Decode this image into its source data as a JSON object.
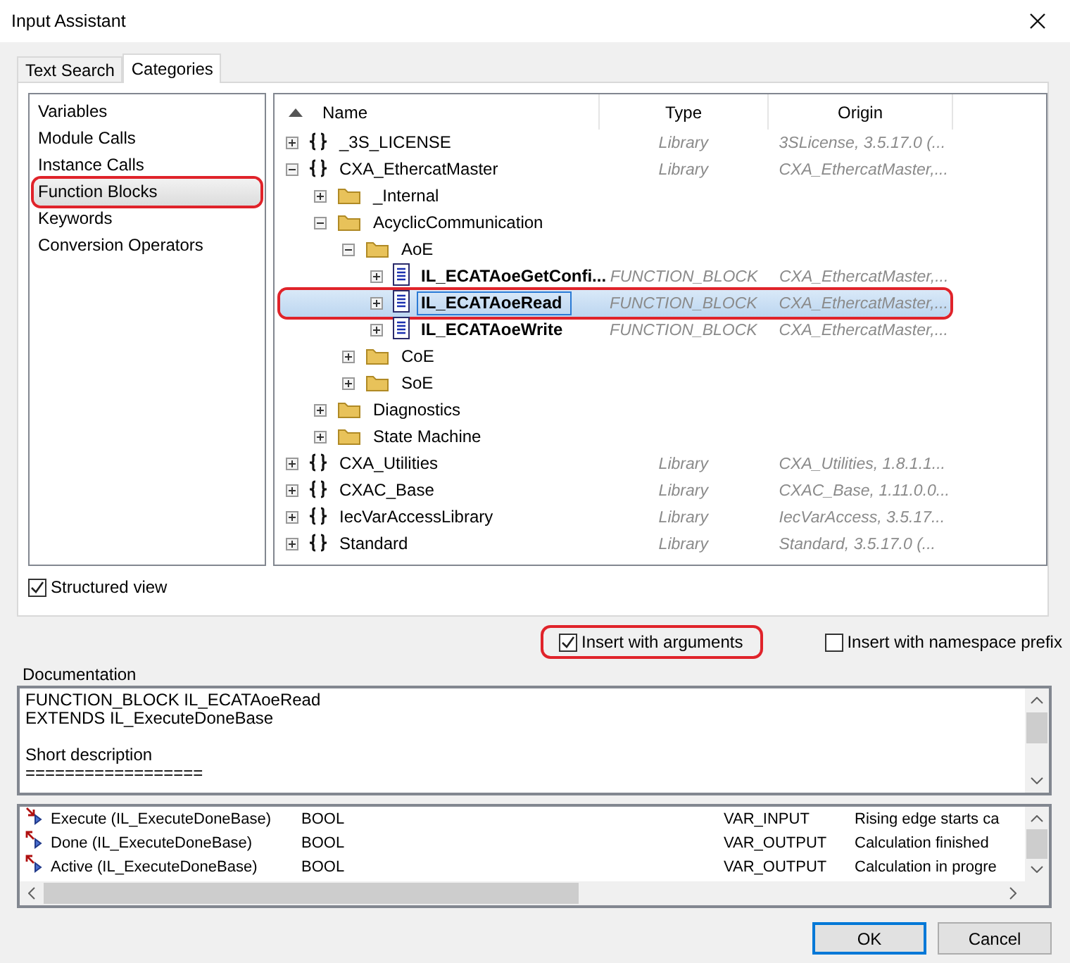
{
  "window": {
    "title": "Input Assistant"
  },
  "tabs": [
    {
      "label": "Text Search",
      "selected": false
    },
    {
      "label": "Categories",
      "selected": true
    }
  ],
  "categories": [
    {
      "label": "Variables",
      "selected": false,
      "marked": false
    },
    {
      "label": "Module Calls",
      "selected": false,
      "marked": false
    },
    {
      "label": "Instance Calls",
      "selected": false,
      "marked": false
    },
    {
      "label": "Function Blocks",
      "selected": true,
      "marked": true
    },
    {
      "label": "Keywords",
      "selected": false,
      "marked": false
    },
    {
      "label": "Conversion Operators",
      "selected": false,
      "marked": false
    }
  ],
  "tree": {
    "columns": [
      "Name",
      "Type",
      "Origin"
    ],
    "nodes": [
      {
        "kind": "library",
        "name": "_3S_LICENSE",
        "type": "Library",
        "origin": "3SLicense, 3.5.17.0 (...",
        "expanded": false,
        "selected": false,
        "marked": false
      },
      {
        "kind": "library",
        "name": "CXA_EthercatMaster",
        "type": "Library",
        "origin": "CXA_EthercatMaster,...",
        "expanded": true,
        "selected": false,
        "marked": false,
        "children": [
          {
            "kind": "folder",
            "name": "_Internal",
            "expanded": false,
            "selected": false,
            "marked": false
          },
          {
            "kind": "folder",
            "name": "AcyclicCommunication",
            "expanded": true,
            "selected": false,
            "marked": false,
            "children": [
              {
                "kind": "folder",
                "name": "AoE",
                "expanded": true,
                "selected": false,
                "marked": false,
                "children": [
                  {
                    "kind": "function_block",
                    "name": "IL_ECATAoeGetConfi...",
                    "type": "FUNCTION_BLOCK",
                    "origin": "CXA_EthercatMaster,...",
                    "expanded": false,
                    "selected": false,
                    "marked": false
                  },
                  {
                    "kind": "function_block",
                    "name": "IL_ECATAoeRead",
                    "type": "FUNCTION_BLOCK",
                    "origin": "CXA_EthercatMaster,...",
                    "expanded": false,
                    "selected": true,
                    "marked": true
                  },
                  {
                    "kind": "function_block",
                    "name": "IL_ECATAoeWrite",
                    "type": "FUNCTION_BLOCK",
                    "origin": "CXA_EthercatMaster,...",
                    "expanded": false,
                    "selected": false,
                    "marked": false
                  }
                ]
              },
              {
                "kind": "folder",
                "name": "CoE",
                "expanded": false,
                "selected": false,
                "marked": false
              },
              {
                "kind": "folder",
                "name": "SoE",
                "expanded": false,
                "selected": false,
                "marked": false
              }
            ]
          },
          {
            "kind": "folder",
            "name": "Diagnostics",
            "expanded": false,
            "selected": false,
            "marked": false
          },
          {
            "kind": "folder",
            "name": "State Machine",
            "expanded": false,
            "selected": false,
            "marked": false
          }
        ]
      },
      {
        "kind": "library",
        "name": "CXA_Utilities",
        "type": "Library",
        "origin": "CXA_Utilities, 1.8.1.1...",
        "expanded": false,
        "selected": false,
        "marked": false
      },
      {
        "kind": "library",
        "name": "CXAC_Base",
        "type": "Library",
        "origin": "CXAC_Base, 1.11.0.0...",
        "expanded": false,
        "selected": false,
        "marked": false
      },
      {
        "kind": "library",
        "name": "IecVarAccessLibrary",
        "type": "Library",
        "origin": "IecVarAccess, 3.5.17...",
        "expanded": false,
        "selected": false,
        "marked": false
      },
      {
        "kind": "library",
        "name": "Standard",
        "type": "Library",
        "origin": "Standard, 3.5.17.0 (...",
        "expanded": false,
        "selected": false,
        "marked": false
      }
    ]
  },
  "structured_view": {
    "label": "Structured view",
    "checked": true
  },
  "options": [
    {
      "label": "Insert with arguments",
      "checked": true,
      "marked": true
    },
    {
      "label": "Insert with namespace prefix",
      "checked": false,
      "marked": false
    }
  ],
  "documentation": {
    "label": "Documentation",
    "paragraphs": [
      [
        "FUNCTION_BLOCK IL_ECATAoeRead",
        "EXTENDS IL_ExecuteDoneBase"
      ],
      [
        "Short description",
        "=================="
      ]
    ]
  },
  "parameters": [
    {
      "kind": "input",
      "name": "Execute (IL_ExecuteDoneBase)",
      "type": "BOOL",
      "scope": "VAR_INPUT",
      "comment": "Rising edge starts ca"
    },
    {
      "kind": "output",
      "name": "Done (IL_ExecuteDoneBase)",
      "type": "BOOL",
      "scope": "VAR_OUTPUT",
      "comment": "Calculation finished"
    },
    {
      "kind": "output",
      "name": "Active (IL_ExecuteDoneBase)",
      "type": "BOOL",
      "scope": "VAR_OUTPUT",
      "comment": "Calculation in progre"
    }
  ],
  "buttons": [
    {
      "label": "OK",
      "default": true
    },
    {
      "label": "Cancel",
      "default": false
    }
  ]
}
